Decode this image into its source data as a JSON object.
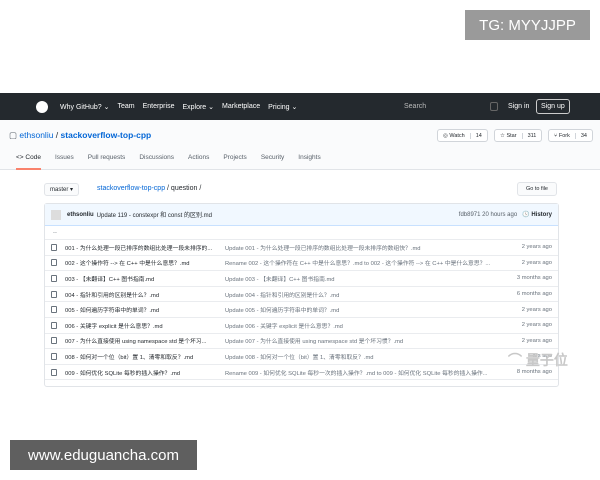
{
  "watermarks": {
    "top": "TG: MYYJJPP",
    "bottom": "www.eduguancha.com",
    "logo": "量子位"
  },
  "nav": {
    "items": [
      "Why GitHub? ⌄",
      "Team",
      "Enterprise",
      "Explore ⌄",
      "Marketplace",
      "Pricing ⌄"
    ],
    "search": "Search",
    "signin": "Sign in",
    "signup": "Sign up"
  },
  "repo": {
    "owner": "ethsonliu",
    "name": "stackoverflow-top-cpp",
    "watch": "Watch",
    "watch_count": "14",
    "star": "Star",
    "star_count": "311",
    "fork": "Fork",
    "fork_count": "34"
  },
  "tabs": [
    "<> Code",
    "Issues",
    "Pull requests",
    "Discussions",
    "Actions",
    "Projects",
    "Security",
    "Insights"
  ],
  "branch": "master ▾",
  "breadcrumb": {
    "repo": "stackoverflow-top-cpp",
    "path": "/ question /"
  },
  "goto": "Go to file",
  "commit": {
    "author": "ethsonliu",
    "message": "Update 119 - constexpr 和 const 的区别.md",
    "sha": "fdb8971",
    "time": "20 hours ago",
    "history": "History"
  },
  "up": "..",
  "files": [
    {
      "name": "001 - 为什么处理一段已排序的数组比处理一段未排序的...",
      "msg": "Update 001 - 为什么处理一段已排序的数组比处理一段未排序的数组快？.md",
      "age": "2 years ago"
    },
    {
      "name": "002 - 这个操作符 --> 在 C++ 中是什么意思？.md",
      "msg": "Rename 002 - 这个操作符在 C++ 中是什么意思？.md to 002 - 这个操作符 --> 在 C++ 中是什么意思？...",
      "age": "2 years ago"
    },
    {
      "name": "003 - 【未翻译】C++ 图书指南.md",
      "msg": "Update 003 - 【未翻译】C++ 图书指南.md",
      "age": "3 months ago"
    },
    {
      "name": "004 - 指针和引用的区别是什么？.md",
      "msg": "Update 004 - 指针和引用的区别是什么？.md",
      "age": "6 months ago"
    },
    {
      "name": "005 - 如何遍历字符串中的单词？.md",
      "msg": "Update 005 - 如何遍历字符串中的单词？.md",
      "age": "2 years ago"
    },
    {
      "name": "006 - 关键字 explicit 是什么意思？.md",
      "msg": "Update 006 - 关键字 explicit 是什么意思？.md",
      "age": "2 years ago"
    },
    {
      "name": "007 - 为什么直接使用 using namespace std 是个坏习...",
      "msg": "Update 007 - 为什么直接使用 using namespace std 是个坏习惯？.md",
      "age": "2 years ago"
    },
    {
      "name": "008 - 如何对一个位（bit）置 1、清零和取反？.md",
      "msg": "Update 008 - 如何对一个位（bit）置 1、清零和取反？.md",
      "age": "ars ago"
    },
    {
      "name": "009 - 如何优化 SQLite 每秒的插入操作？.md",
      "msg": "Rename 009 - 如何优化 SQLite 每秒一次的插入操作？.md to 009 - 如何优化 SQLite 每秒的插入操作...",
      "age": "8 months ago"
    }
  ]
}
